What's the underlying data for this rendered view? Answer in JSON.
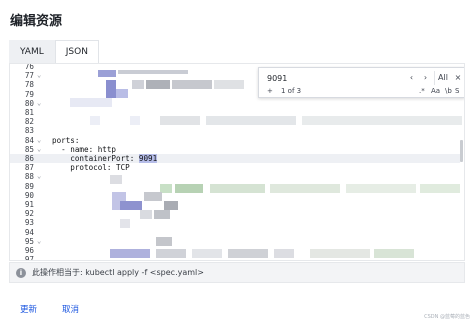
{
  "dialog": {
    "title": "编辑资源"
  },
  "tabs": [
    {
      "label": "YAML",
      "active": false
    },
    {
      "label": "JSON",
      "active": true
    }
  ],
  "editor": {
    "lines": [
      {
        "number": "76",
        "fold": "",
        "code": ""
      },
      {
        "number": "77",
        "fold": "⌄",
        "code": ""
      },
      {
        "number": "78",
        "fold": "",
        "code": ""
      },
      {
        "number": "79",
        "fold": "",
        "code": ""
      },
      {
        "number": "80",
        "fold": "⌄",
        "code": ""
      },
      {
        "number": "81",
        "fold": "",
        "code": ""
      },
      {
        "number": "82",
        "fold": "",
        "code": ""
      },
      {
        "number": "83",
        "fold": "",
        "code": ""
      },
      {
        "number": "84",
        "fold": "⌄",
        "code": "ports:"
      },
      {
        "number": "85",
        "fold": "⌄",
        "code": "  - name: http"
      },
      {
        "number": "86",
        "fold": "",
        "code": "    containerPort: ",
        "highlight": "9091"
      },
      {
        "number": "87",
        "fold": "",
        "code": "    protocol: TCP"
      },
      {
        "number": "88",
        "fold": "⌄",
        "code": ""
      },
      {
        "number": "89",
        "fold": "",
        "code": ""
      },
      {
        "number": "90",
        "fold": "",
        "code": ""
      },
      {
        "number": "91",
        "fold": "",
        "code": ""
      },
      {
        "number": "92",
        "fold": "",
        "code": ""
      },
      {
        "number": "93",
        "fold": "",
        "code": ""
      },
      {
        "number": "94",
        "fold": "",
        "code": ""
      },
      {
        "number": "95",
        "fold": "⌄",
        "code": ""
      },
      {
        "number": "96",
        "fold": "",
        "code": ""
      },
      {
        "number": "97",
        "fold": "",
        "code": ""
      }
    ],
    "current_line": "86"
  },
  "find_widget": {
    "query": "9091",
    "prev_label": "‹",
    "next_label": "›",
    "all_label": "All",
    "close_label": "×",
    "expand_label": "+",
    "match_count": "1 of 3",
    "option_regex": ".*",
    "option_case": "Aa",
    "option_word": "\\b",
    "option_select": "S"
  },
  "info": {
    "icon": "i",
    "text": "此操作相当于: kubectl apply -f <spec.yaml>"
  },
  "actions": {
    "update_label": "更新",
    "cancel_label": "取消"
  },
  "watermark": "CSDN @蓝莓的蓝色",
  "colors": {
    "accent": "#1a55e0",
    "selection": "#b6bde8",
    "current_line": "#eef0f4"
  }
}
